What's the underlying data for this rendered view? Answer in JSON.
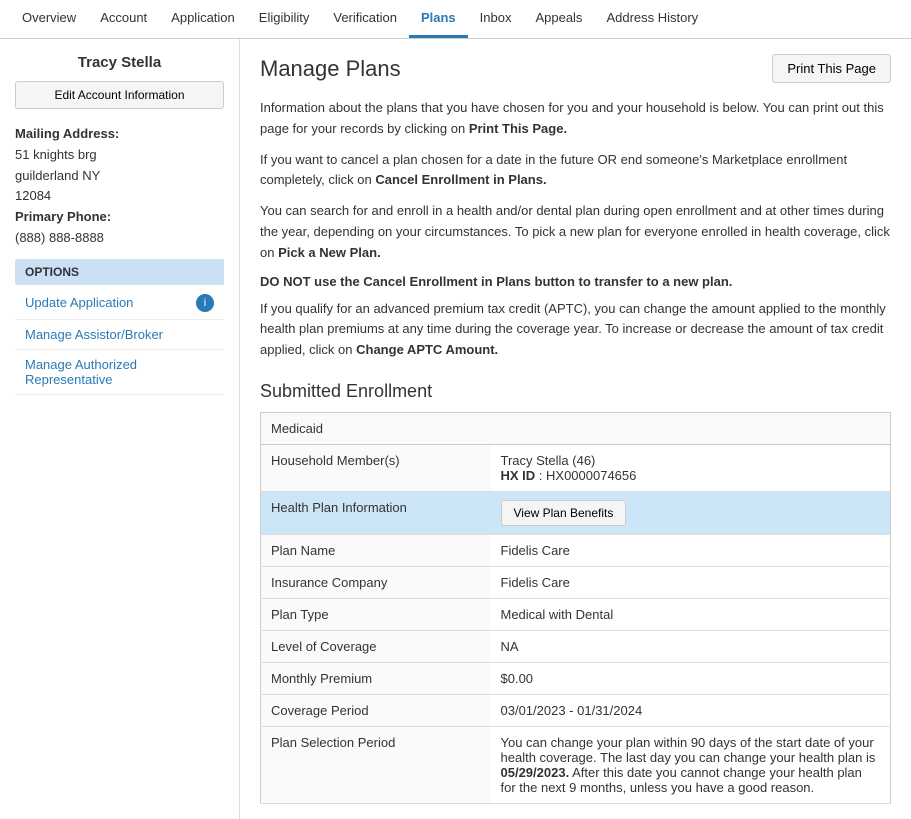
{
  "nav": {
    "items": [
      {
        "label": "Overview",
        "active": false
      },
      {
        "label": "Account",
        "active": false
      },
      {
        "label": "Application",
        "active": false
      },
      {
        "label": "Eligibility",
        "active": false
      },
      {
        "label": "Verification",
        "active": false
      },
      {
        "label": "Plans",
        "active": true
      },
      {
        "label": "Inbox",
        "active": false
      },
      {
        "label": "Appeals",
        "active": false
      },
      {
        "label": "Address History",
        "active": false
      }
    ]
  },
  "sidebar": {
    "user_name": "Tracy Stella",
    "edit_button": "Edit Account Information",
    "mailing_label": "Mailing Address:",
    "address_line1": "51 knights brg",
    "address_line2": "guilderland NY",
    "address_line3": "12084",
    "phone_label": "Primary Phone:",
    "phone": "(888) 888-8888",
    "options_header": "OPTIONS",
    "links": [
      {
        "label": "Update Application",
        "has_icon": true
      },
      {
        "label": "Manage Assistor/Broker",
        "has_icon": false
      },
      {
        "label": "Manage Authorized Representative",
        "has_icon": false
      }
    ]
  },
  "main": {
    "page_title": "Manage Plans",
    "print_button": "Print This Page",
    "info1": "Information about the plans that you have chosen for you and your household is below. You can print out this page for your records by clicking on ",
    "info1_bold": "Print This Page.",
    "info2_start": "If you want to cancel a plan chosen for a date in the future OR end someone's Marketplace enrollment completely, click on ",
    "info2_bold": "Cancel Enrollment in Plans.",
    "info3_start": "You can search for and enroll in a health and/or dental plan during open enrollment and at other times during the year, depending on your circumstances. To pick a new plan for everyone enrolled in health coverage, click on ",
    "info3_bold": "Pick a New Plan.",
    "warning": "DO NOT use the Cancel Enrollment in Plans button to transfer to a new plan.",
    "info4_start": "If you qualify for an advanced premium tax credit (APTC), you can change the amount applied to the monthly health plan premiums at any time during the coverage year. To increase or decrease the amount of tax credit applied, click on ",
    "info4_bold": "Change APTC Amount.",
    "section_title": "Submitted Enrollment",
    "table": {
      "medicaid_header": "Medicaid",
      "household_label": "Household Member(s)",
      "household_member": "Tracy Stella (46)",
      "hx_id_label": "HX ID",
      "hx_id_value": "HX0000074656",
      "hp_info_label": "Health Plan Information",
      "view_plan_btn": "View Plan Benefits",
      "plan_name_label": "Plan Name",
      "plan_name_value": "Fidelis Care",
      "insurance_label": "Insurance Company",
      "insurance_value": "Fidelis Care",
      "plan_type_label": "Plan Type",
      "plan_type_value": "Medical with Dental",
      "coverage_level_label": "Level of Coverage",
      "coverage_level_value": "NA",
      "monthly_premium_label": "Monthly Premium",
      "monthly_premium_value": "$0.00",
      "coverage_period_label": "Coverage Period",
      "coverage_period_value": "03/01/2023 - 01/31/2024",
      "plan_selection_label": "Plan Selection Period",
      "plan_selection_value": "You can change your plan within 90 days of the start date of your health coverage. The last day you can change your health plan is ",
      "plan_selection_bold": "05/29/2023.",
      "plan_selection_end": " After this date you cannot change your health plan for the next 9 months, unless you have a good reason."
    }
  }
}
